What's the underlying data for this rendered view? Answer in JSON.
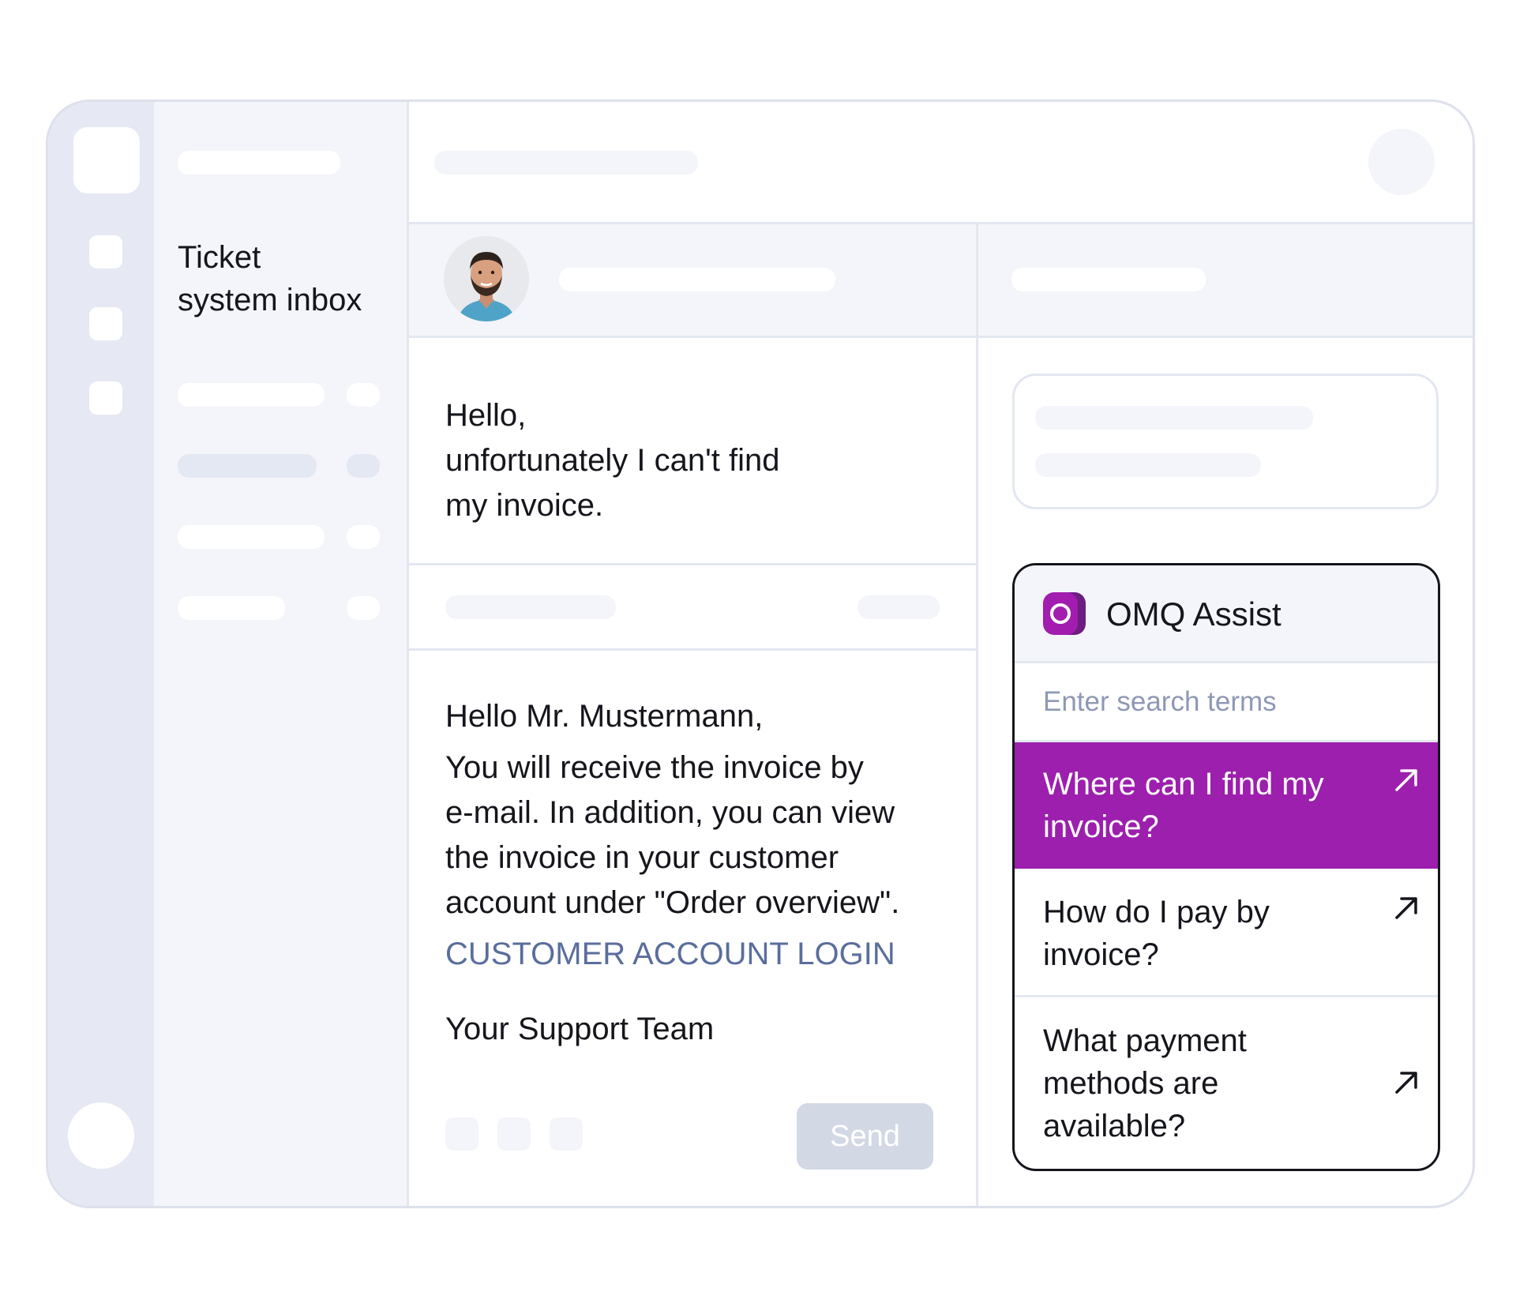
{
  "sidebar": {
    "title": "Ticket\nsystem inbox"
  },
  "ticket": {
    "customer_message": "Hello,\nunfortunately I can't find\nmy invoice."
  },
  "reply": {
    "greeting": "Hello Mr. Mustermann,",
    "body": "You will receive the invoice by\ne-mail. In addition, you can view\nthe invoice in your customer\naccount under \"Order overview\".",
    "link": "CUSTOMER ACCOUNT LOGIN",
    "signature": "Your Support Team",
    "send_label": "Send"
  },
  "assist": {
    "title": "OMQ Assist",
    "search_placeholder": "Enter search terms",
    "suggestions": [
      {
        "text": "Where can I find my invoice?",
        "active": true
      },
      {
        "text": "How do I pay by invoice?",
        "active": false
      },
      {
        "text": "What payment methods are available?",
        "active": false
      }
    ]
  },
  "colors": {
    "accent": "#9c1fad",
    "link": "#5a6e9c",
    "placeholder_light": "#f3f5fa",
    "placeholder_dark": "#e4e8f2"
  },
  "icons": {
    "assist_logo": "omq-logo-icon",
    "suggestion_arrow": "arrow-up-right-icon"
  }
}
